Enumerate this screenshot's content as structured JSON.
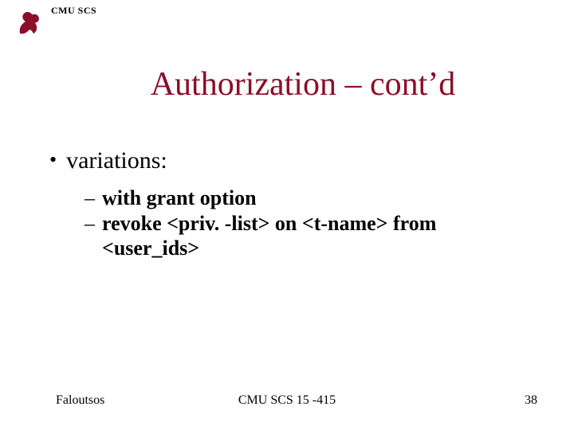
{
  "header": {
    "org_label": "CMU SCS",
    "logo_color": "#8a0f2a"
  },
  "title": "Authorization – cont’d",
  "bullets": {
    "top": "variations:",
    "sub1": "with grant option",
    "sub2": "revoke <priv. -list> on <t-name> from",
    "sub2_cont": "<user_ids>"
  },
  "footer": {
    "left": "Faloutsos",
    "center": "CMU SCS 15 -415",
    "right": "38"
  }
}
